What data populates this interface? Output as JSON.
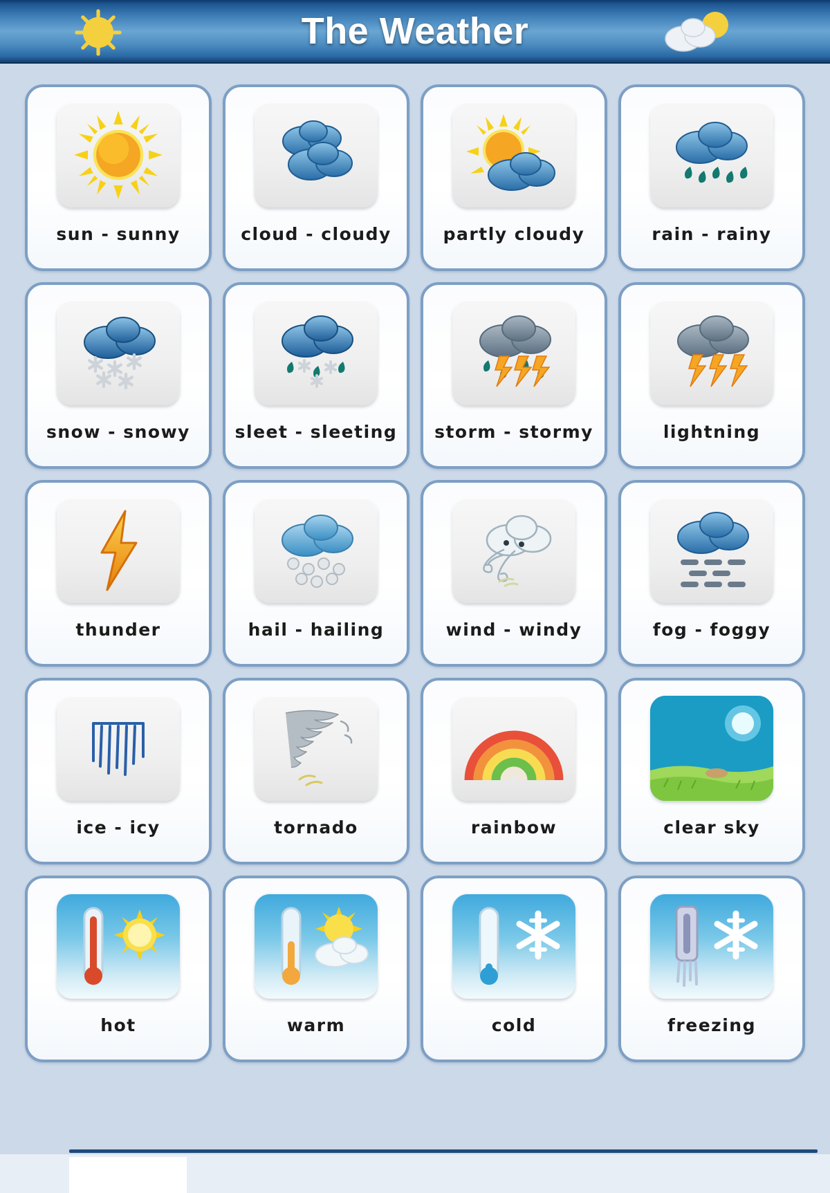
{
  "header": {
    "title": "The Weather",
    "left_icon": "sun-icon",
    "right_icon": "sun-behind-cloud-icon"
  },
  "colors": {
    "page_background": "#ccd9e8",
    "card_border": "#7d9fc4",
    "card_background": "#ffffff",
    "tile_background": "#efefef",
    "header_gradient_dark": "#0d3a6b",
    "header_gradient_light": "#6aa6d3",
    "title_text": "#ffffff",
    "caption_text": "#1b1b1b",
    "cloud_blue": "#2f7cb8",
    "cloud_gray": "#7c8b99",
    "lightning_orange": "#f5a623",
    "rain_teal": "#14796f",
    "clear_sky_blue": "#1a9cc4",
    "footer_rule": "#1e4a7d"
  },
  "grid": {
    "columns": 4,
    "rows": 5,
    "cards": [
      {
        "label": "sun - sunny",
        "icon": "sun-icon"
      },
      {
        "label": "cloud - cloudy",
        "icon": "clouds-icon"
      },
      {
        "label": "partly cloudy",
        "icon": "sun-behind-cloud-icon"
      },
      {
        "label": "rain - rainy",
        "icon": "rain-cloud-icon"
      },
      {
        "label": "snow - snowy",
        "icon": "snow-cloud-icon"
      },
      {
        "label": "sleet - sleeting",
        "icon": "sleet-cloud-icon"
      },
      {
        "label": "storm - stormy",
        "icon": "storm-cloud-icon"
      },
      {
        "label": "lightning",
        "icon": "lightning-cloud-icon"
      },
      {
        "label": "thunder",
        "icon": "lightning-bolt-icon"
      },
      {
        "label": "hail - hailing",
        "icon": "hail-cloud-icon"
      },
      {
        "label": "wind - windy",
        "icon": "wind-cloud-icon"
      },
      {
        "label": "fog - foggy",
        "icon": "fog-cloud-icon"
      },
      {
        "label": "ice - icy",
        "icon": "icicles-icon"
      },
      {
        "label": "tornado",
        "icon": "tornado-icon"
      },
      {
        "label": "rainbow",
        "icon": "rainbow-icon"
      },
      {
        "label": "clear sky",
        "icon": "clear-sky-icon"
      },
      {
        "label": "hot",
        "icon": "thermometer-hot-icon"
      },
      {
        "label": "warm",
        "icon": "thermometer-warm-icon"
      },
      {
        "label": "cold",
        "icon": "thermometer-cold-icon"
      },
      {
        "label": "freezing",
        "icon": "thermometer-freezing-icon"
      }
    ]
  }
}
